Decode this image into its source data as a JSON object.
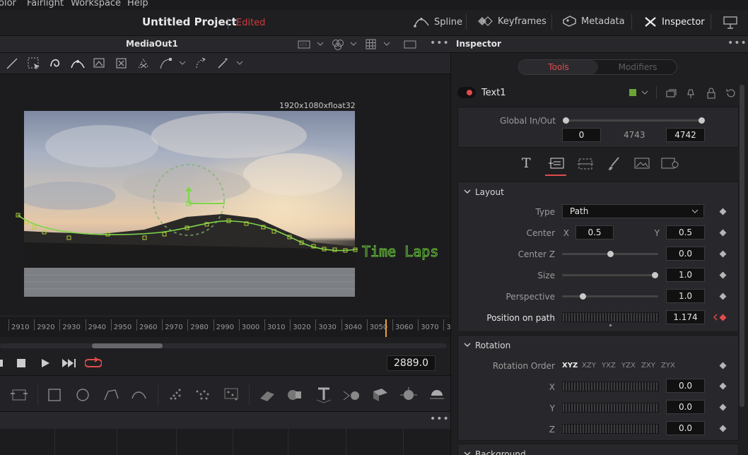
{
  "menu": {
    "items": [
      "olor",
      "Fairlight",
      "Workspace",
      "Help"
    ]
  },
  "project": {
    "title": "Untitled Project",
    "status": "Edited"
  },
  "toolbar_right": {
    "spline": "Spline",
    "keyframes": "Keyframes",
    "metadata": "Metadata",
    "inspector": "Inspector"
  },
  "viewer": {
    "title": "MediaOut1",
    "resolution": "1920x1080xfloat32",
    "overlay_text": "Time Laps"
  },
  "ruler": {
    "ticks": [
      "2910",
      "2920",
      "2930",
      "2940",
      "2950",
      "2960",
      "2970",
      "2980",
      "2990",
      "3000",
      "3010",
      "3020",
      "3030",
      "3040",
      "3050",
      "3060",
      "3070",
      "3"
    ]
  },
  "transport": {
    "timecode": "2889.0"
  },
  "inspector": {
    "title": "Inspector",
    "tabs": {
      "tools": "Tools",
      "modifiers": "Modifiers"
    },
    "node_name": "Text1",
    "global": {
      "label": "Global In/Out",
      "in": "0",
      "mid": "4743",
      "out": "4742"
    },
    "layout": {
      "title": "Layout",
      "type_label": "Type",
      "type_value": "Path",
      "center_label": "Center",
      "center_x_label": "X",
      "center_x": "0.5",
      "center_y_label": "Y",
      "center_y": "0.5",
      "center_z_label": "Center Z",
      "center_z": "0.0",
      "size_label": "Size",
      "size": "1.0",
      "perspective_label": "Perspective",
      "perspective": "1.0",
      "position_label": "Position on path",
      "position": "1.174"
    },
    "rotation": {
      "title": "Rotation",
      "order_label": "Rotation Order",
      "orders": [
        "XYZ",
        "XZY",
        "YXZ",
        "YZX",
        "ZXY",
        "ZYX"
      ],
      "x_label": "X",
      "x": "0.0",
      "y_label": "Y",
      "y": "0.0",
      "z_label": "Z",
      "z": "0.0"
    },
    "background_partial": "Background"
  },
  "colors": {
    "accent_red": "#e24b4b",
    "spline_green": "#7fd64a",
    "keyframe_red": "#e24b4b",
    "playhead": "#e8a23a"
  }
}
